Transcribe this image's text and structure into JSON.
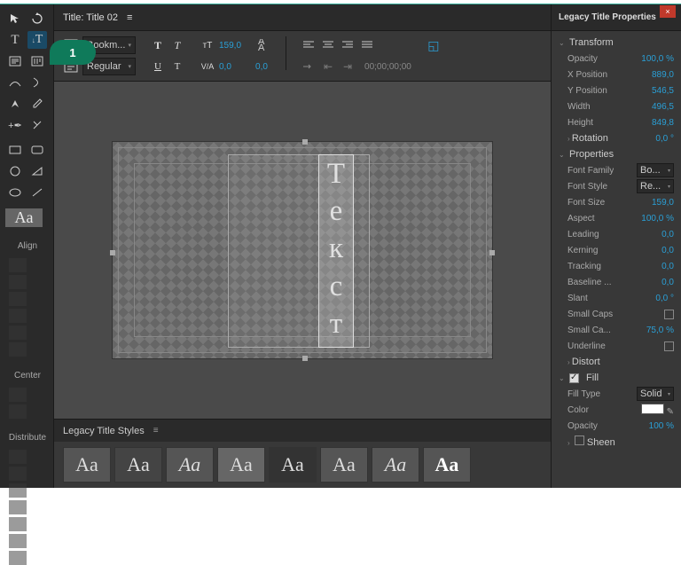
{
  "close_label": "×",
  "callout_number": "1",
  "title_header": "Title: Title 02",
  "styles_header": "Legacy Title Styles",
  "props_header": "Legacy Title Properties",
  "tool_preview": "Aa",
  "style_swatch_label": "Aa",
  "align_label": "Align",
  "center_label": "Center",
  "distribute_label": "Distribute",
  "vertical_text": [
    "Т",
    "е",
    "к",
    "с",
    "т"
  ],
  "toolbar": {
    "font_family": "Bookm...",
    "font_style": "Regular",
    "t_btn": "T",
    "size_label": "159,0",
    "kerning_label": "0,0",
    "leading_label": "0,0",
    "timecode": "00;00;00;00"
  },
  "sections": {
    "transform": "Transform",
    "properties": "Properties",
    "fill": "Fill",
    "sheen": "Sheen",
    "distort": "Distort"
  },
  "props": {
    "opacity": {
      "l": "Opacity",
      "v": "100,0 %"
    },
    "xpos": {
      "l": "X Position",
      "v": "889,0"
    },
    "ypos": {
      "l": "Y Position",
      "v": "546,5"
    },
    "width": {
      "l": "Width",
      "v": "496,5"
    },
    "height": {
      "l": "Height",
      "v": "849,8"
    },
    "rotation": {
      "l": "Rotation",
      "v": "0,0 °"
    },
    "fontfamily": {
      "l": "Font Family",
      "v": "Bo..."
    },
    "fontstyle": {
      "l": "Font Style",
      "v": "Re..."
    },
    "fontsize": {
      "l": "Font Size",
      "v": "159,0"
    },
    "aspect": {
      "l": "Aspect",
      "v": "100,0 %"
    },
    "leading": {
      "l": "Leading",
      "v": "0,0"
    },
    "kerning": {
      "l": "Kerning",
      "v": "0,0"
    },
    "tracking": {
      "l": "Tracking",
      "v": "0,0"
    },
    "baseline": {
      "l": "Baseline ...",
      "v": "0,0"
    },
    "slant": {
      "l": "Slant",
      "v": "0,0 °"
    },
    "smallcaps": {
      "l": "Small Caps"
    },
    "smallcapsize": {
      "l": "Small Ca...",
      "v": "75,0 %"
    },
    "underline": {
      "l": "Underline"
    },
    "filltype": {
      "l": "Fill Type",
      "v": "Solid"
    },
    "color": {
      "l": "Color"
    },
    "fillopacity": {
      "l": "Opacity",
      "v": "100 %"
    }
  }
}
